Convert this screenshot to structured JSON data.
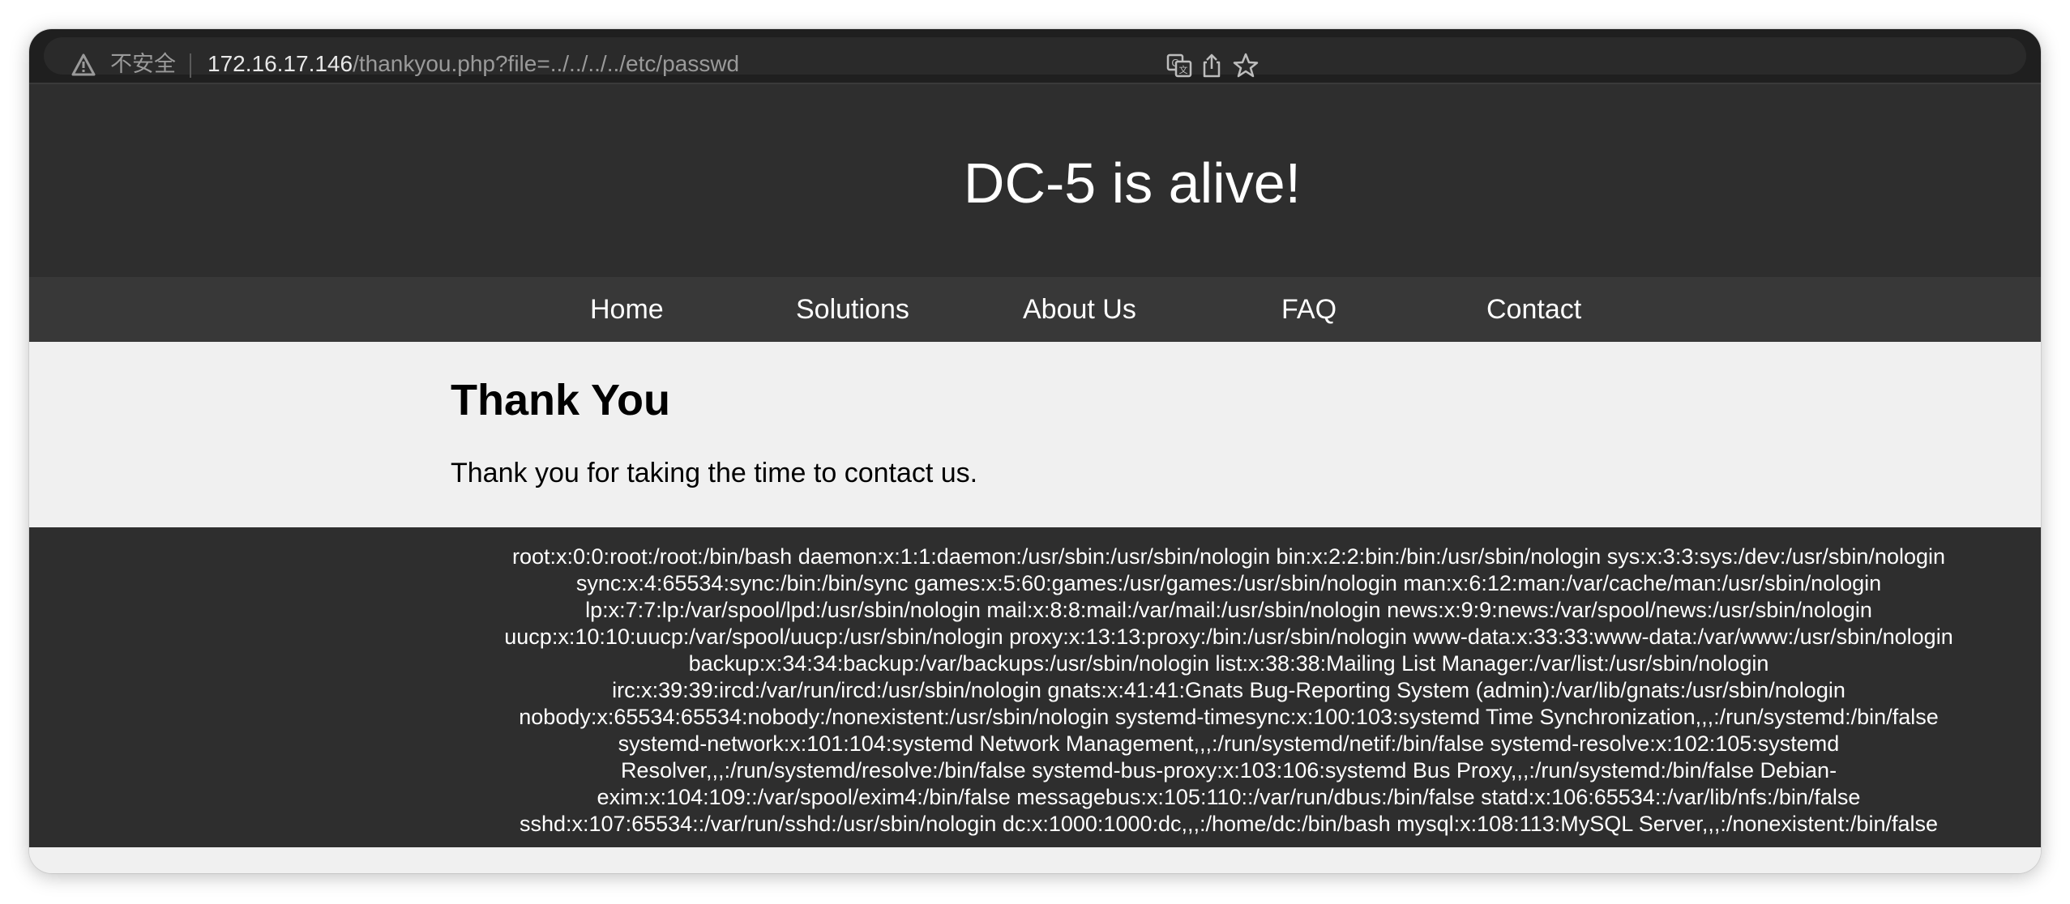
{
  "browser": {
    "security_label": "不安全",
    "url_host": "172.16.17.146",
    "url_path": "/thankyou.php?file=../../../../etc/passwd",
    "icons": [
      "warning-icon",
      "translate-icon",
      "share-icon",
      "bookmark-star-icon"
    ]
  },
  "site": {
    "title": "DC-5 is alive!",
    "nav": [
      "Home",
      "Solutions",
      "About Us",
      "FAQ",
      "Contact"
    ]
  },
  "content": {
    "heading": "Thank You",
    "message": "Thank you for taking the time to contact us."
  },
  "footer": {
    "lines": [
      "root:x:0:0:root:/root:/bin/bash daemon:x:1:1:daemon:/usr/sbin:/usr/sbin/nologin bin:x:2:2:bin:/bin:/usr/sbin/nologin sys:x:3:3:sys:/dev:/usr/sbin/nologin",
      "sync:x:4:65534:sync:/bin:/bin/sync games:x:5:60:games:/usr/games:/usr/sbin/nologin man:x:6:12:man:/var/cache/man:/usr/sbin/nologin",
      "lp:x:7:7:lp:/var/spool/lpd:/usr/sbin/nologin mail:x:8:8:mail:/var/mail:/usr/sbin/nologin news:x:9:9:news:/var/spool/news:/usr/sbin/nologin",
      "uucp:x:10:10:uucp:/var/spool/uucp:/usr/sbin/nologin proxy:x:13:13:proxy:/bin:/usr/sbin/nologin www-data:x:33:33:www-data:/var/www:/usr/sbin/nologin",
      "backup:x:34:34:backup:/var/backups:/usr/sbin/nologin list:x:38:38:Mailing List Manager:/var/list:/usr/sbin/nologin",
      "irc:x:39:39:ircd:/var/run/ircd:/usr/sbin/nologin gnats:x:41:41:Gnats Bug-Reporting System (admin):/var/lib/gnats:/usr/sbin/nologin",
      "nobody:x:65534:65534:nobody:/nonexistent:/usr/sbin/nologin systemd-timesync:x:100:103:systemd Time Synchronization,,,:/run/systemd:/bin/false",
      "systemd-network:x:101:104:systemd Network Management,,,:/run/systemd/netif:/bin/false systemd-resolve:x:102:105:systemd",
      "Resolver,,,:/run/systemd/resolve:/bin/false systemd-bus-proxy:x:103:106:systemd Bus Proxy,,,:/run/systemd:/bin/false Debian-",
      "exim:x:104:109::/var/spool/exim4:/bin/false messagebus:x:105:110::/var/run/dbus:/bin/false statd:x:106:65534::/var/lib/nfs:/bin/false",
      "sshd:x:107:65534::/var/run/sshd:/usr/sbin/nologin dc:x:1000:1000:dc,,,:/home/dc:/bin/bash mysql:x:108:113:MySQL Server,,,:/nonexistent:/bin/false"
    ]
  },
  "colors": {
    "header_bg": "#2e2e2e",
    "nav_bg": "#383838",
    "content_bg": "#f0f0f0",
    "browser_bar_bg": "#1f1f1f"
  }
}
